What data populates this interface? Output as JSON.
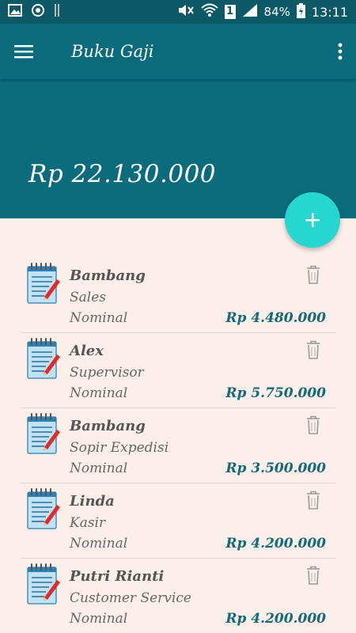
{
  "status_bar": {
    "battery": "84%",
    "time": "13:11",
    "sim_slot": "1",
    "icons": [
      "image-icon",
      "sync-icon",
      "pause-bars-icon",
      "mute-icon",
      "wifi-icon",
      "sim-icon",
      "signal-icon",
      "battery-icon"
    ]
  },
  "app_bar": {
    "title": "Buku Gaji",
    "menu_icon": "hamburger-icon",
    "overflow_icon": "more-vert-icon"
  },
  "header": {
    "total": "Rp 22.130.000"
  },
  "fab": {
    "icon": "plus-icon",
    "color": "#26d7d1"
  },
  "colors": {
    "primary": "#0a6b7c",
    "status_bar": "#0b5866",
    "background": "#fcefe9",
    "accent": "#26d7d1",
    "amount": "#126a7a"
  },
  "employees": [
    {
      "name": "Bambang",
      "role": "Sales",
      "nominal_label": "Nominal",
      "amount": "Rp 4.480.000"
    },
    {
      "name": "Alex",
      "role": "Supervisor",
      "nominal_label": "Nominal",
      "amount": "Rp 5.750.000"
    },
    {
      "name": "Bambang",
      "role": "Sopir Expedisi",
      "nominal_label": "Nominal",
      "amount": "Rp 3.500.000"
    },
    {
      "name": "Linda",
      "role": "Kasir",
      "nominal_label": "Nominal",
      "amount": "Rp 4.200.000"
    },
    {
      "name": "Putri Rianti",
      "role": "Customer Service",
      "nominal_label": "Nominal",
      "amount": "Rp 4.200.000"
    }
  ]
}
